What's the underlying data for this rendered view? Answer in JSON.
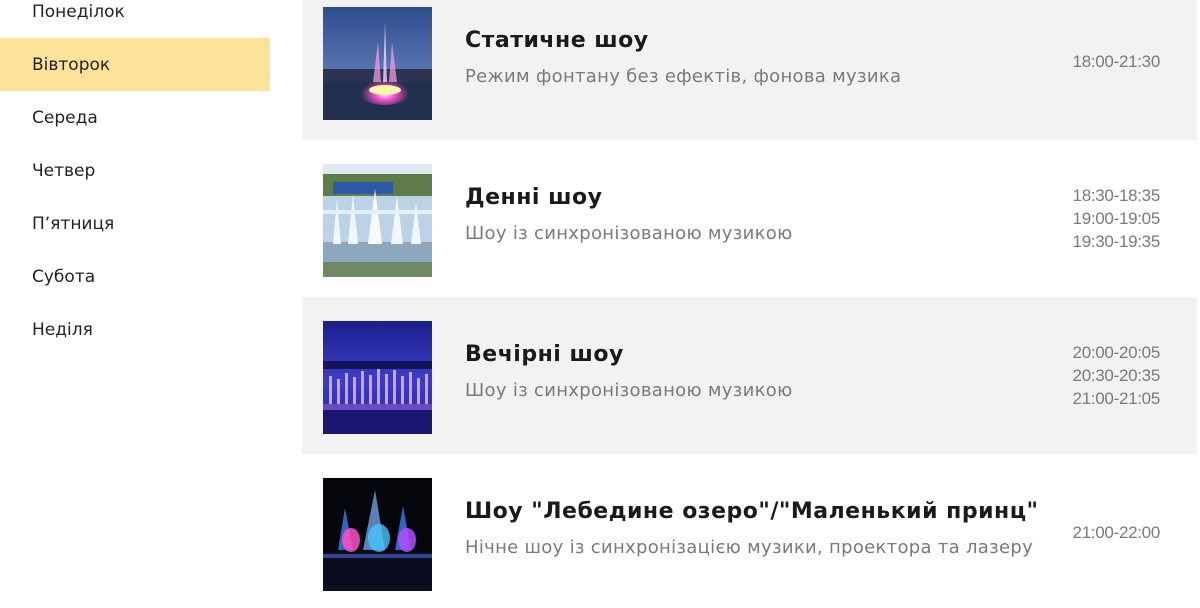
{
  "sidebar": {
    "days": [
      {
        "label": "Понеділок",
        "active": false
      },
      {
        "label": "Вівторок",
        "active": true
      },
      {
        "label": "Середа",
        "active": false
      },
      {
        "label": "Четвер",
        "active": false
      },
      {
        "label": "Пʼятниця",
        "active": false
      },
      {
        "label": "Субота",
        "active": false
      },
      {
        "label": "Неділя",
        "active": false
      }
    ]
  },
  "colors": {
    "active_day_bg": "#fbe49a",
    "alt_row_bg": "#f2f2f2"
  },
  "shows": [
    {
      "title": "Статичне шоу",
      "description": "Режим фонтану без ефектів, фонова музика",
      "times": [
        "18:00-21:30"
      ],
      "thumbnail": "evening-fountain-pink-photo"
    },
    {
      "title": "Денні шоу",
      "description": "Шоу із синхронізованою музикою",
      "times": [
        "18:30-18:35",
        "19:00-19:05",
        "19:30-19:35"
      ],
      "thumbnail": "daytime-fountain-photo"
    },
    {
      "title": "Вечірні шоу",
      "description": "Шоу із синхронізованою музикою",
      "times": [
        "20:00-20:05",
        "20:30-20:35",
        "21:00-21:05"
      ],
      "thumbnail": "twilight-fountain-purple-photo"
    },
    {
      "title": "Шоу \"Лебедине озеро\"/\"Маленький принц\"",
      "description": "Нічне шоу із синхронізацією музики, проектора та лазеру",
      "times": [
        "21:00-22:00"
      ],
      "thumbnail": "night-fountain-laser-photo"
    }
  ]
}
